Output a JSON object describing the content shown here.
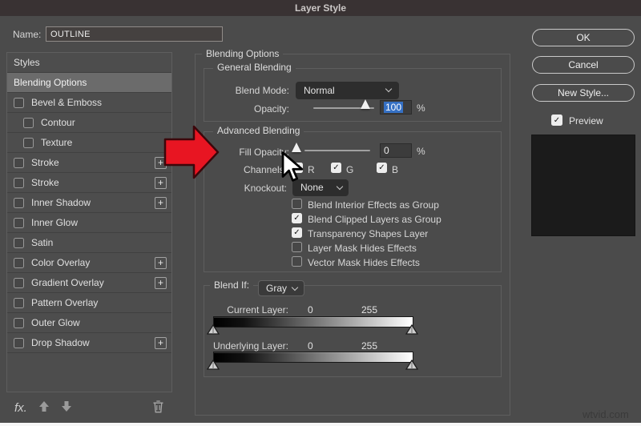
{
  "window": {
    "title": "Layer Style"
  },
  "name_row": {
    "label": "Name:",
    "value": "OUTLINE"
  },
  "icons": {
    "check": "✓",
    "plus": "+",
    "fx": "fx."
  },
  "sidebar": {
    "items": [
      {
        "label": "Styles"
      },
      {
        "label": "Blending Options",
        "selected": true
      },
      {
        "label": "Bevel & Emboss",
        "checkbox": true,
        "checked": false
      },
      {
        "label": "Contour",
        "checkbox": true,
        "checked": false,
        "indent": true
      },
      {
        "label": "Texture",
        "checkbox": true,
        "checked": false,
        "indent": true
      },
      {
        "label": "Stroke",
        "checkbox": true,
        "checked": false,
        "plus": true
      },
      {
        "label": "Stroke",
        "checkbox": true,
        "checked": false,
        "plus": true
      },
      {
        "label": "Inner Shadow",
        "checkbox": true,
        "checked": false,
        "plus": true
      },
      {
        "label": "Inner Glow",
        "checkbox": true,
        "checked": false
      },
      {
        "label": "Satin",
        "checkbox": true,
        "checked": false
      },
      {
        "label": "Color Overlay",
        "checkbox": true,
        "checked": false,
        "plus": true
      },
      {
        "label": "Gradient Overlay",
        "checkbox": true,
        "checked": false,
        "plus": true
      },
      {
        "label": "Pattern Overlay",
        "checkbox": true,
        "checked": false
      },
      {
        "label": "Outer Glow",
        "checkbox": true,
        "checked": false
      },
      {
        "label": "Drop Shadow",
        "checkbox": true,
        "checked": false,
        "plus": true
      }
    ]
  },
  "panel": {
    "section_title": "Blending Options",
    "general": {
      "title": "General Blending",
      "blend_mode_label": "Blend Mode:",
      "blend_mode_value": "Normal",
      "opacity_label": "Opacity:",
      "opacity_value": "100",
      "opacity_unit": "%"
    },
    "advanced": {
      "title": "Advanced Blending",
      "fill_opacity_label": "Fill Opacity:",
      "fill_opacity_value": "0",
      "fill_opacity_unit": "%",
      "channels_label": "Channels:",
      "channels": [
        {
          "label": "R",
          "checked": true
        },
        {
          "label": "G",
          "checked": true
        },
        {
          "label": "B",
          "checked": true
        }
      ],
      "knockout_label": "Knockout:",
      "knockout_value": "None",
      "options": [
        {
          "label": "Blend Interior Effects as Group",
          "checked": false
        },
        {
          "label": "Blend Clipped Layers as Group",
          "checked": true
        },
        {
          "label": "Transparency Shapes Layer",
          "checked": true
        },
        {
          "label": "Layer Mask Hides Effects",
          "checked": false
        },
        {
          "label": "Vector Mask Hides Effects",
          "checked": false
        }
      ]
    },
    "blend_if": {
      "label": "Blend If:",
      "value": "Gray",
      "current_layer_label": "Current Layer:",
      "current_min": "0",
      "current_max": "255",
      "underlying_layer_label": "Underlying Layer:",
      "underlying_min": "0",
      "underlying_max": "255"
    }
  },
  "actions": {
    "ok": "OK",
    "cancel": "Cancel",
    "new_style": "New Style...",
    "preview_label": "Preview",
    "preview_checked": true
  },
  "watermark": "wtvid.com",
  "colors": {
    "arrow_red": "#e81522",
    "selection_blue": "#3570c4",
    "preview_swatch": "#1b1b1b",
    "titlebar": "#393233"
  }
}
